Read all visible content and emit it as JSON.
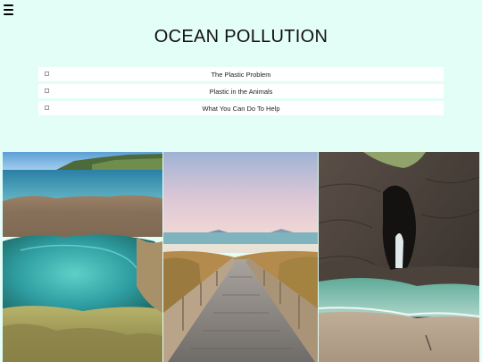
{
  "header": {
    "menu_icon": "hamburger-menu-icon",
    "title": "OCEAN POLLUTION"
  },
  "nav": {
    "items": [
      {
        "label": "The Plastic Problem"
      },
      {
        "label": "Plastic in the Animals"
      },
      {
        "label": "What You Can Do To Help"
      }
    ]
  },
  "gallery": {
    "photos": [
      {
        "subject": "rock-pool-by-the-sea"
      },
      {
        "subject": "wooden-boardwalk-to-beach"
      },
      {
        "subject": "sea-cave-arch-on-beach"
      }
    ]
  },
  "colors": {
    "page_background": "#e3fdf7",
    "nav_item_background": "#ffffff"
  }
}
